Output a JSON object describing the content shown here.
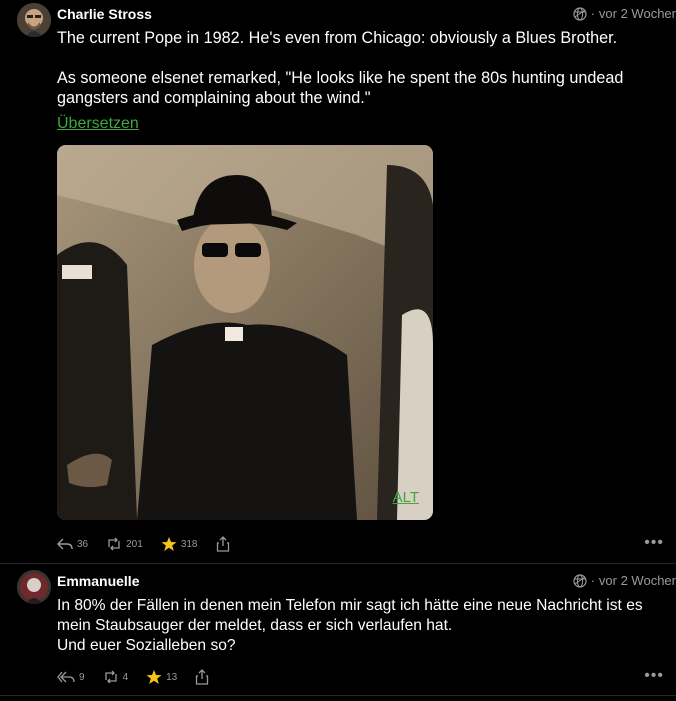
{
  "posts": [
    {
      "author": "Charlie Stross",
      "time": "vor 2 Wocher",
      "paragraphs": [
        "The current Pope in 1982. He's even from Chicago: obviously a Blues Brother.",
        "As someone elsenet remarked, \"He looks like he spent the 80s hunting undead gangsters and complaining about the wind.\""
      ],
      "translate": "Übersetzen",
      "media_alt_label": "ALT",
      "replies": "36",
      "boosts": "201",
      "favourites": "318",
      "icons": [
        "reply-icon",
        "boost-icon",
        "star-icon",
        "share-icon",
        "more-icon"
      ]
    },
    {
      "author": "Emmanuelle",
      "time": "vor 2 Wocher",
      "lines": [
        "In 80% der Fällen in denen mein Telefon mir sagt ich hätte eine neue Nachricht ist es",
        "mein Staubsauger der meldet, dass er sich verlaufen hat.",
        "Und euer Sozialleben so?"
      ],
      "replies": "9",
      "boosts": "4",
      "favourites": "13"
    }
  ],
  "colors": {
    "background": "#000000",
    "link": "#3ea83e",
    "muted": "#9a9a9a",
    "star": "#f5c518"
  }
}
